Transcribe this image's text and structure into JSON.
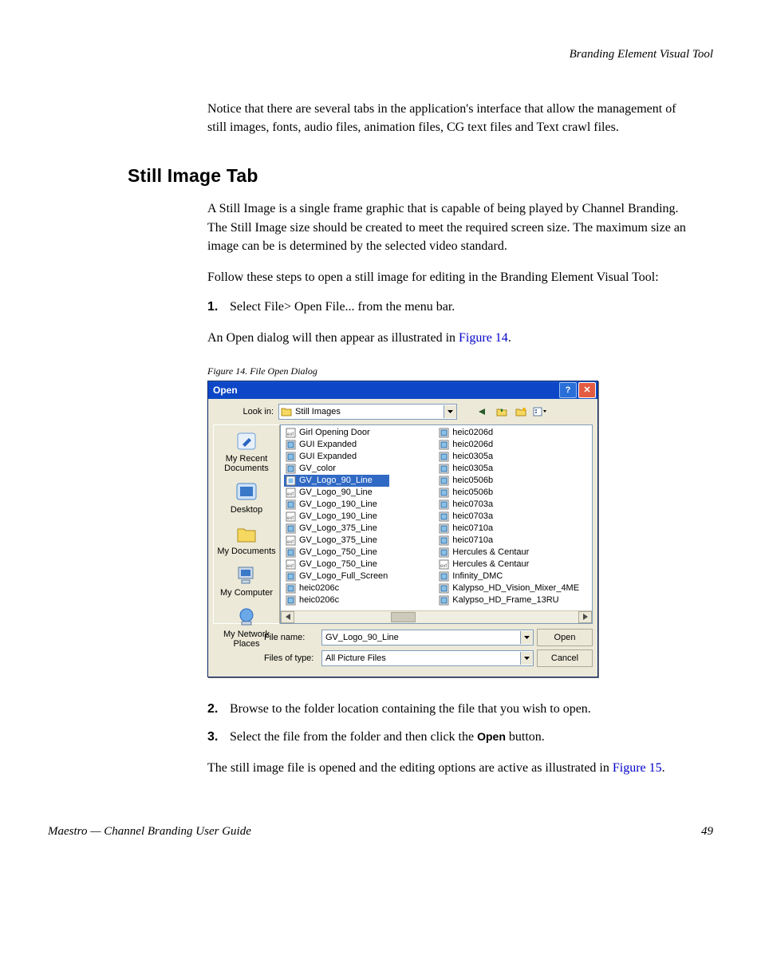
{
  "header": {
    "running_head": "Branding Element Visual Tool"
  },
  "intro_para": "Notice that there are several tabs in the application's interface that allow the management of still images, fonts, audio files, animation files, CG text files and Text crawl files.",
  "section_title": "Still Image Tab",
  "para1": "A Still Image is a single frame graphic that is capable of being played by Channel Branding. The Still Image size should be created to meet the required screen size. The maximum size an image can be is determined by the selected video standard.",
  "para2": "Follow these steps to open a still image for editing in the Branding Element Visual Tool:",
  "step1": {
    "num": "1.",
    "text": "Select File> Open File... from the menu bar."
  },
  "para3_prefix": "An Open dialog will then appear as illustrated in ",
  "para3_link": "Figure 14",
  "para3_suffix": ".",
  "figure_caption": "Figure 14.  File Open Dialog",
  "dialog": {
    "title": "Open",
    "lookin_label": "Look in:",
    "lookin_value": "Still Images",
    "places": [
      {
        "label_line1": "My Recent",
        "label_line2": "Documents"
      },
      {
        "label_line1": "Desktop",
        "label_line2": ""
      },
      {
        "label_line1": "My Documents",
        "label_line2": ""
      },
      {
        "label_line1": "My Computer",
        "label_line2": ""
      },
      {
        "label_line1": "My Network",
        "label_line2": "Places"
      }
    ],
    "files_col1": [
      {
        "name": "Girl Opening Door",
        "type": "exf"
      },
      {
        "name": "GUI Expanded",
        "type": "img"
      },
      {
        "name": "GUI Expanded",
        "type": "img"
      },
      {
        "name": "GV_color",
        "type": "img"
      },
      {
        "name": "GV_Logo_90_Line",
        "type": "img",
        "selected": true
      },
      {
        "name": "GV_Logo_90_Line",
        "type": "exf"
      },
      {
        "name": "GV_Logo_190_Line",
        "type": "img"
      },
      {
        "name": "GV_Logo_190_Line",
        "type": "exf"
      },
      {
        "name": "GV_Logo_375_Line",
        "type": "img"
      },
      {
        "name": "GV_Logo_375_Line",
        "type": "exf"
      },
      {
        "name": "GV_Logo_750_Line",
        "type": "img"
      },
      {
        "name": "GV_Logo_750_Line",
        "type": "exf"
      },
      {
        "name": "GV_Logo_Full_Screen",
        "type": "img"
      },
      {
        "name": "heic0206c",
        "type": "img"
      },
      {
        "name": "heic0206c",
        "type": "img"
      }
    ],
    "files_col2": [
      {
        "name": "heic0206d",
        "type": "img"
      },
      {
        "name": "heic0206d",
        "type": "img"
      },
      {
        "name": "heic0305a",
        "type": "img"
      },
      {
        "name": "heic0305a",
        "type": "img"
      },
      {
        "name": "heic0506b",
        "type": "img"
      },
      {
        "name": "heic0506b",
        "type": "img"
      },
      {
        "name": "heic0703a",
        "type": "img"
      },
      {
        "name": "heic0703a",
        "type": "img"
      },
      {
        "name": "heic0710a",
        "type": "img"
      },
      {
        "name": "heic0710a",
        "type": "img"
      },
      {
        "name": "Hercules & Centaur",
        "type": "img"
      },
      {
        "name": "Hercules & Centaur",
        "type": "exf"
      },
      {
        "name": "Infinity_DMC",
        "type": "img"
      },
      {
        "name": "Kalypso_HD_Vision_Mixer_4ME",
        "type": "img"
      },
      {
        "name": "Kalypso_HD_Frame_13RU",
        "type": "img"
      }
    ],
    "filename_label": "File name:",
    "filename_value": "GV_Logo_90_Line",
    "filetype_label": "Files of type:",
    "filetype_value": "All Picture Files",
    "open_btn": "Open",
    "cancel_btn": "Cancel"
  },
  "step2": {
    "num": "2.",
    "text": "Browse to the folder location containing the file that you wish to open."
  },
  "step3": {
    "num": "3.",
    "prefix": "Select the file from the folder and then click the ",
    "bold": "Open",
    "suffix": " button."
  },
  "closing_prefix": "The still image file is opened and the editing options are active as illustrated in ",
  "closing_link": "Figure 15",
  "closing_suffix": ".",
  "footer": {
    "left": "Maestro — Channel Branding User Guide",
    "right": "49"
  }
}
